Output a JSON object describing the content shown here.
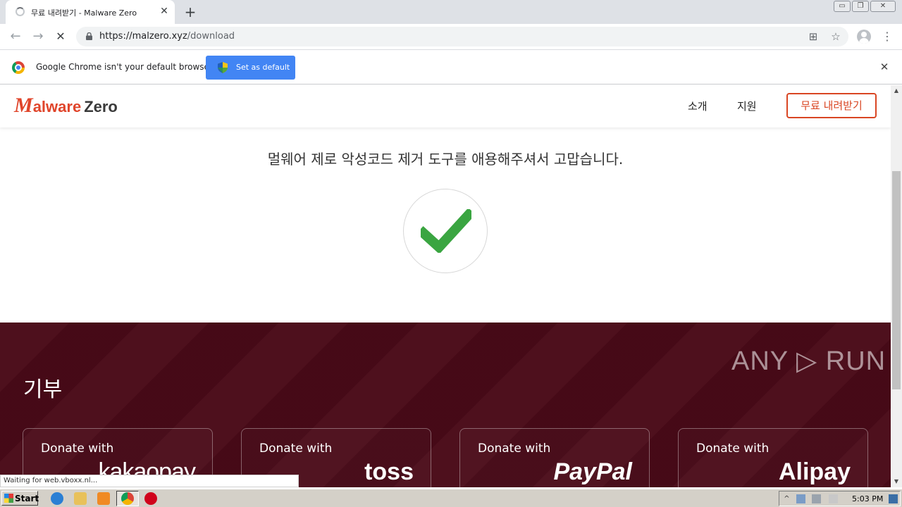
{
  "browser": {
    "tab_title": "무료 내려받기 - Malware Zero",
    "tab_close": "✕",
    "new_tab": "+",
    "url_host": "https://malzero.xyz",
    "url_path": "/download",
    "back": "←",
    "forward": "→",
    "reload": "✕",
    "translate_icon": "⊞",
    "bookmark_icon": "☆",
    "menu_icon": "⋮",
    "window_controls": [
      "▭",
      "❐",
      "✕"
    ]
  },
  "infobar": {
    "message": "Google Chrome isn't your default browser",
    "button_label": "Set as default",
    "close": "✕"
  },
  "site": {
    "logo_m": "M",
    "logo_rest": "alware",
    "logo_zero": "Zero",
    "nav": [
      "소개",
      "지원"
    ],
    "download_label": "무료 내려받기",
    "thanks": "멀웨어 제로 악성코드 제거 도구를 애용해주셔서 고맙습니다.",
    "accent_color": "#d94623",
    "check_color": "#3aa541"
  },
  "donate": {
    "title": "기부",
    "background": "#4a0a18",
    "cards": [
      {
        "label": "Donate with",
        "brand": "kakaopay"
      },
      {
        "label": "Donate with",
        "brand": "toss"
      },
      {
        "label": "Donate with",
        "brand": "PayPal"
      },
      {
        "label": "Donate with",
        "brand": "Alipay"
      }
    ]
  },
  "watermark": "ANY ▷ RUN",
  "status": "Waiting for web.vboxx.nl...",
  "taskbar": {
    "start": "Start",
    "clock": "5:03 PM"
  }
}
